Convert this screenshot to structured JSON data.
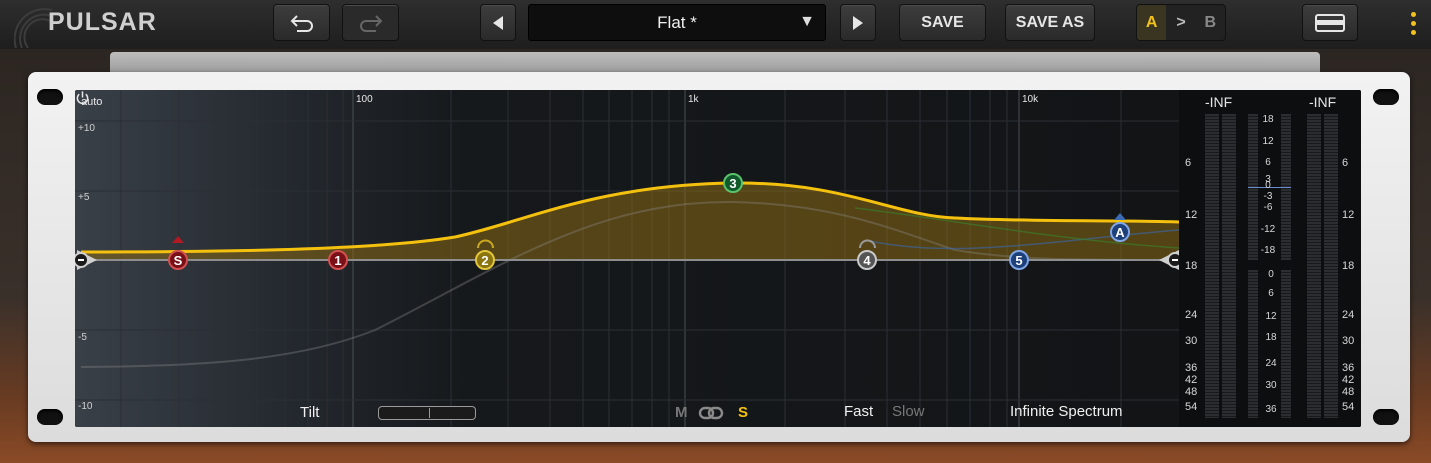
{
  "app": {
    "logo": "PULSAR"
  },
  "toolbar": {
    "preset_name": "Flat *",
    "save_label": "SAVE",
    "save_as_label": "SAVE AS",
    "ab": {
      "a": "A",
      "arrow": ">",
      "b": "B"
    }
  },
  "eq": {
    "auto_label": "auto",
    "freq_labels": [
      "100",
      "1k",
      "10k"
    ],
    "db_labels": [
      "+10",
      "+5",
      "-5",
      "-10"
    ],
    "nodes": [
      "S",
      "1",
      "2",
      "3",
      "4",
      "5",
      "A"
    ],
    "tilt_label": "Tilt",
    "mode_m": "M",
    "mode_s": "S",
    "speed_fast": "Fast",
    "speed_slow": "Slow",
    "spectrum_mode": "Infinite Spectrum",
    "colors": {
      "curve": "#f5c10f",
      "node_red": "#7a1018",
      "node_yellow": "#8a7410",
      "node_green": "#10592a",
      "node_grey": "#555555",
      "node_blue": "#1d3f7a"
    }
  },
  "meters": {
    "left_peak": "-INF",
    "right_peak": "-INF",
    "outer_scale": [
      "6",
      "12",
      "18",
      "24",
      "30",
      "36",
      "42",
      "48",
      "54"
    ],
    "gr_scale_top": [
      "18",
      "12",
      "6",
      "3",
      "0",
      "-3",
      "-6",
      "-12",
      "-18"
    ],
    "gr_scale_bottom": [
      "0",
      "6",
      "12",
      "18",
      "24",
      "30",
      "36"
    ]
  }
}
